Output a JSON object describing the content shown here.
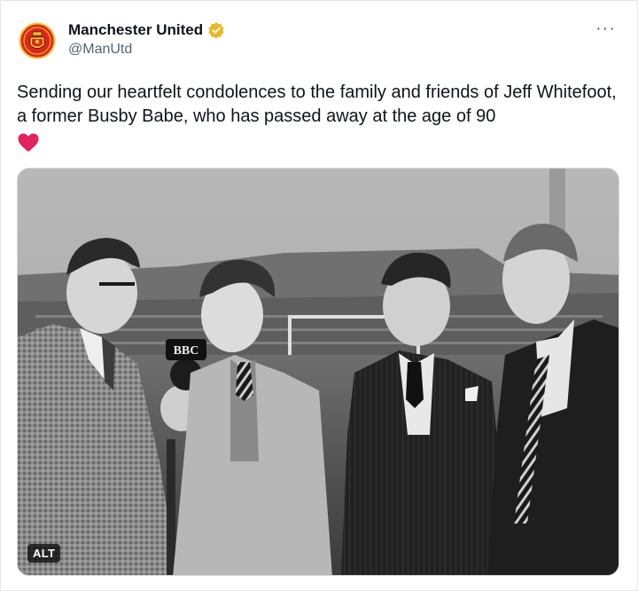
{
  "tweet": {
    "author_name": "Manchester United",
    "author_handle": "@ManUtd",
    "more_label": "···",
    "text": "Sending our heartfelt condolences to the family and friends of Jeff Whitefoot, a former Busby Babe, who has passed away at the age of 90",
    "emoji": "red-heart",
    "verified_badge_color": "#e8b923",
    "heart_color": "#e0245e"
  },
  "media": {
    "microphone_label": "BBC",
    "alt_badge": "ALT"
  },
  "icons": [
    "club-crest-icon",
    "verified-badge-icon",
    "more-options-icon",
    "heart-emoji-icon"
  ]
}
